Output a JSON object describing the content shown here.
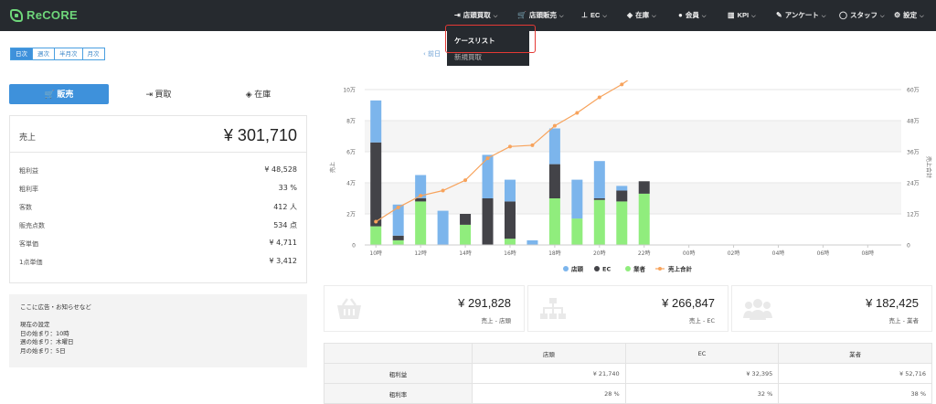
{
  "app": {
    "logo": "ReCORE"
  },
  "nav": [
    {
      "icon": "sign-in-icon",
      "glyph": "⇥",
      "label": "店頭買取"
    },
    {
      "icon": "cart-icon",
      "glyph": "🛒",
      "label": "店頭販売"
    },
    {
      "icon": "sitemap-icon",
      "glyph": "⊥",
      "label": "EC"
    },
    {
      "icon": "cubes-icon",
      "glyph": "◈",
      "label": "在庫"
    },
    {
      "icon": "user-icon",
      "glyph": "●",
      "label": "会員"
    },
    {
      "icon": "bar-chart-icon",
      "glyph": "▥",
      "label": "KPI"
    },
    {
      "icon": "edit-icon",
      "glyph": "✎",
      "label": "アンケート"
    },
    {
      "icon": "person-icon",
      "glyph": "◯",
      "label": "スタッフ"
    },
    {
      "icon": "gear-icon",
      "glyph": "⚙",
      "label": "設定"
    }
  ],
  "dropdown": {
    "items": [
      "ケースリスト",
      "新規買取"
    ]
  },
  "period": [
    "日次",
    "週次",
    "半月次",
    "月次"
  ],
  "prev_link": "‹ 前日",
  "tabs": [
    {
      "icon": "cart-icon",
      "label": "販売"
    },
    {
      "icon": "sign-in-icon",
      "label": "買取"
    },
    {
      "icon": "cubes-icon",
      "label": "在庫"
    }
  ],
  "kpi": {
    "sales_label": "売上",
    "sales_value": "¥ 301,710",
    "rows": [
      {
        "label": "粗利益",
        "value": "¥ 48,528"
      },
      {
        "label": "粗利率",
        "value": "33 %"
      },
      {
        "label": "客数",
        "value": "412 人"
      },
      {
        "label": "販売点数",
        "value": "534 点"
      },
      {
        "label": "客単価",
        "value": "¥ 4,711"
      },
      {
        "label": "1点単価",
        "value": "¥ 3,412"
      }
    ]
  },
  "notice": {
    "lines": [
      "ここに広告・お知らせなど",
      "",
      "現在の設定",
      "日の始まり：10時",
      "週の始まり：木曜日",
      "月の始まり：5日"
    ]
  },
  "cards": [
    {
      "icon": "basket-icon",
      "value": "¥ 291,828",
      "label": "売上 - 店頭"
    },
    {
      "icon": "sitemap-icon",
      "value": "¥ 266,847",
      "label": "売上 - EC"
    },
    {
      "icon": "users-icon",
      "value": "¥ 182,425",
      "label": "売上 - 業者"
    }
  ],
  "table": {
    "headers": [
      "",
      "店頭",
      "EC",
      "業者"
    ],
    "rows": [
      {
        "label": "粗利益",
        "values": [
          "¥ 21,740",
          "¥ 32,395",
          "¥ 52,716"
        ]
      },
      {
        "label": "粗利率",
        "values": [
          "28 %",
          "32 %",
          "38 %"
        ]
      }
    ]
  },
  "colors": {
    "store": "#7cb5ec",
    "ec": "#434348",
    "vendor": "#90ed7d",
    "total": "#f7a35c",
    "accent": "#3e91db"
  },
  "chart_data": {
    "type": "bar",
    "stacked": true,
    "categories": [
      "10時",
      "11時",
      "12時",
      "13時",
      "14時",
      "15時",
      "16時",
      "17時",
      "18時",
      "19時",
      "20時",
      "21時",
      "22時",
      "23時",
      "00時",
      "01時",
      "02時",
      "03時",
      "04時",
      "05時",
      "06時",
      "07時",
      "08時",
      "09時"
    ],
    "x_tick_labels": [
      "10時",
      "12時",
      "14時",
      "16時",
      "18時",
      "20時",
      "22時",
      "00時",
      "02時",
      "04時",
      "06時",
      "08時"
    ],
    "series": [
      {
        "name": "業者",
        "values": [
          12000,
          3000,
          28000,
          0,
          13000,
          0,
          4000,
          0,
          30000,
          17000,
          29000,
          28000,
          33000,
          0,
          0,
          0,
          0,
          0,
          0,
          0,
          0,
          0,
          0,
          0
        ]
      },
      {
        "name": "EC",
        "values": [
          54000,
          3000,
          2000,
          0,
          7000,
          30000,
          24000,
          0,
          22000,
          0,
          1000,
          7000,
          8000,
          0,
          0,
          0,
          0,
          0,
          0,
          0,
          0,
          0,
          0,
          0
        ]
      },
      {
        "name": "店頭",
        "values": [
          27000,
          20000,
          15000,
          22000,
          0,
          28000,
          14000,
          3000,
          23000,
          25000,
          24000,
          3000,
          0,
          0,
          0,
          0,
          0,
          0,
          0,
          0,
          0,
          0,
          0,
          0
        ]
      },
      {
        "name": "売上合計",
        "type": "line",
        "axis": "right",
        "values": [
          9000,
          14500,
          19000,
          21000,
          25000,
          33500,
          38000,
          38500,
          46000,
          51000,
          57000,
          62000,
          68000,
          68000,
          68000,
          68000,
          68000,
          68000,
          68000,
          68000,
          68000,
          68000,
          68000,
          68000
        ]
      }
    ],
    "ylabel": "売上",
    "y2label": "売上合計",
    "ylim": [
      0,
      100000
    ],
    "y2lim": [
      0,
      60000
    ],
    "y_ticks": [
      "0",
      "2万",
      "4万",
      "6万",
      "8万",
      "10万"
    ],
    "y2_ticks": [
      "0",
      "12万",
      "24万",
      "36万",
      "48万",
      "60万"
    ],
    "legend": "bottom",
    "grid": true
  }
}
